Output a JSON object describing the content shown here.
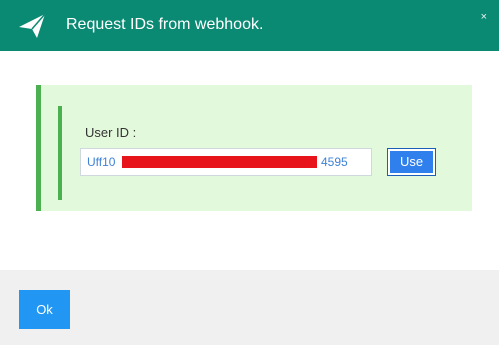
{
  "dialog": {
    "title": "Request IDs from webhook.",
    "close_label": "×",
    "icon": "paper-plane-icon",
    "header_color": "#0b8a73"
  },
  "form": {
    "user_id_label": "User ID :",
    "user_id_prefix": "Uff10",
    "user_id_suffix": "4595",
    "use_button_label": "Use",
    "panel_color": "#e3f9dc",
    "accent_color": "#4caf50"
  },
  "footer": {
    "ok_button_label": "Ok",
    "ok_button_color": "#2196f3"
  }
}
